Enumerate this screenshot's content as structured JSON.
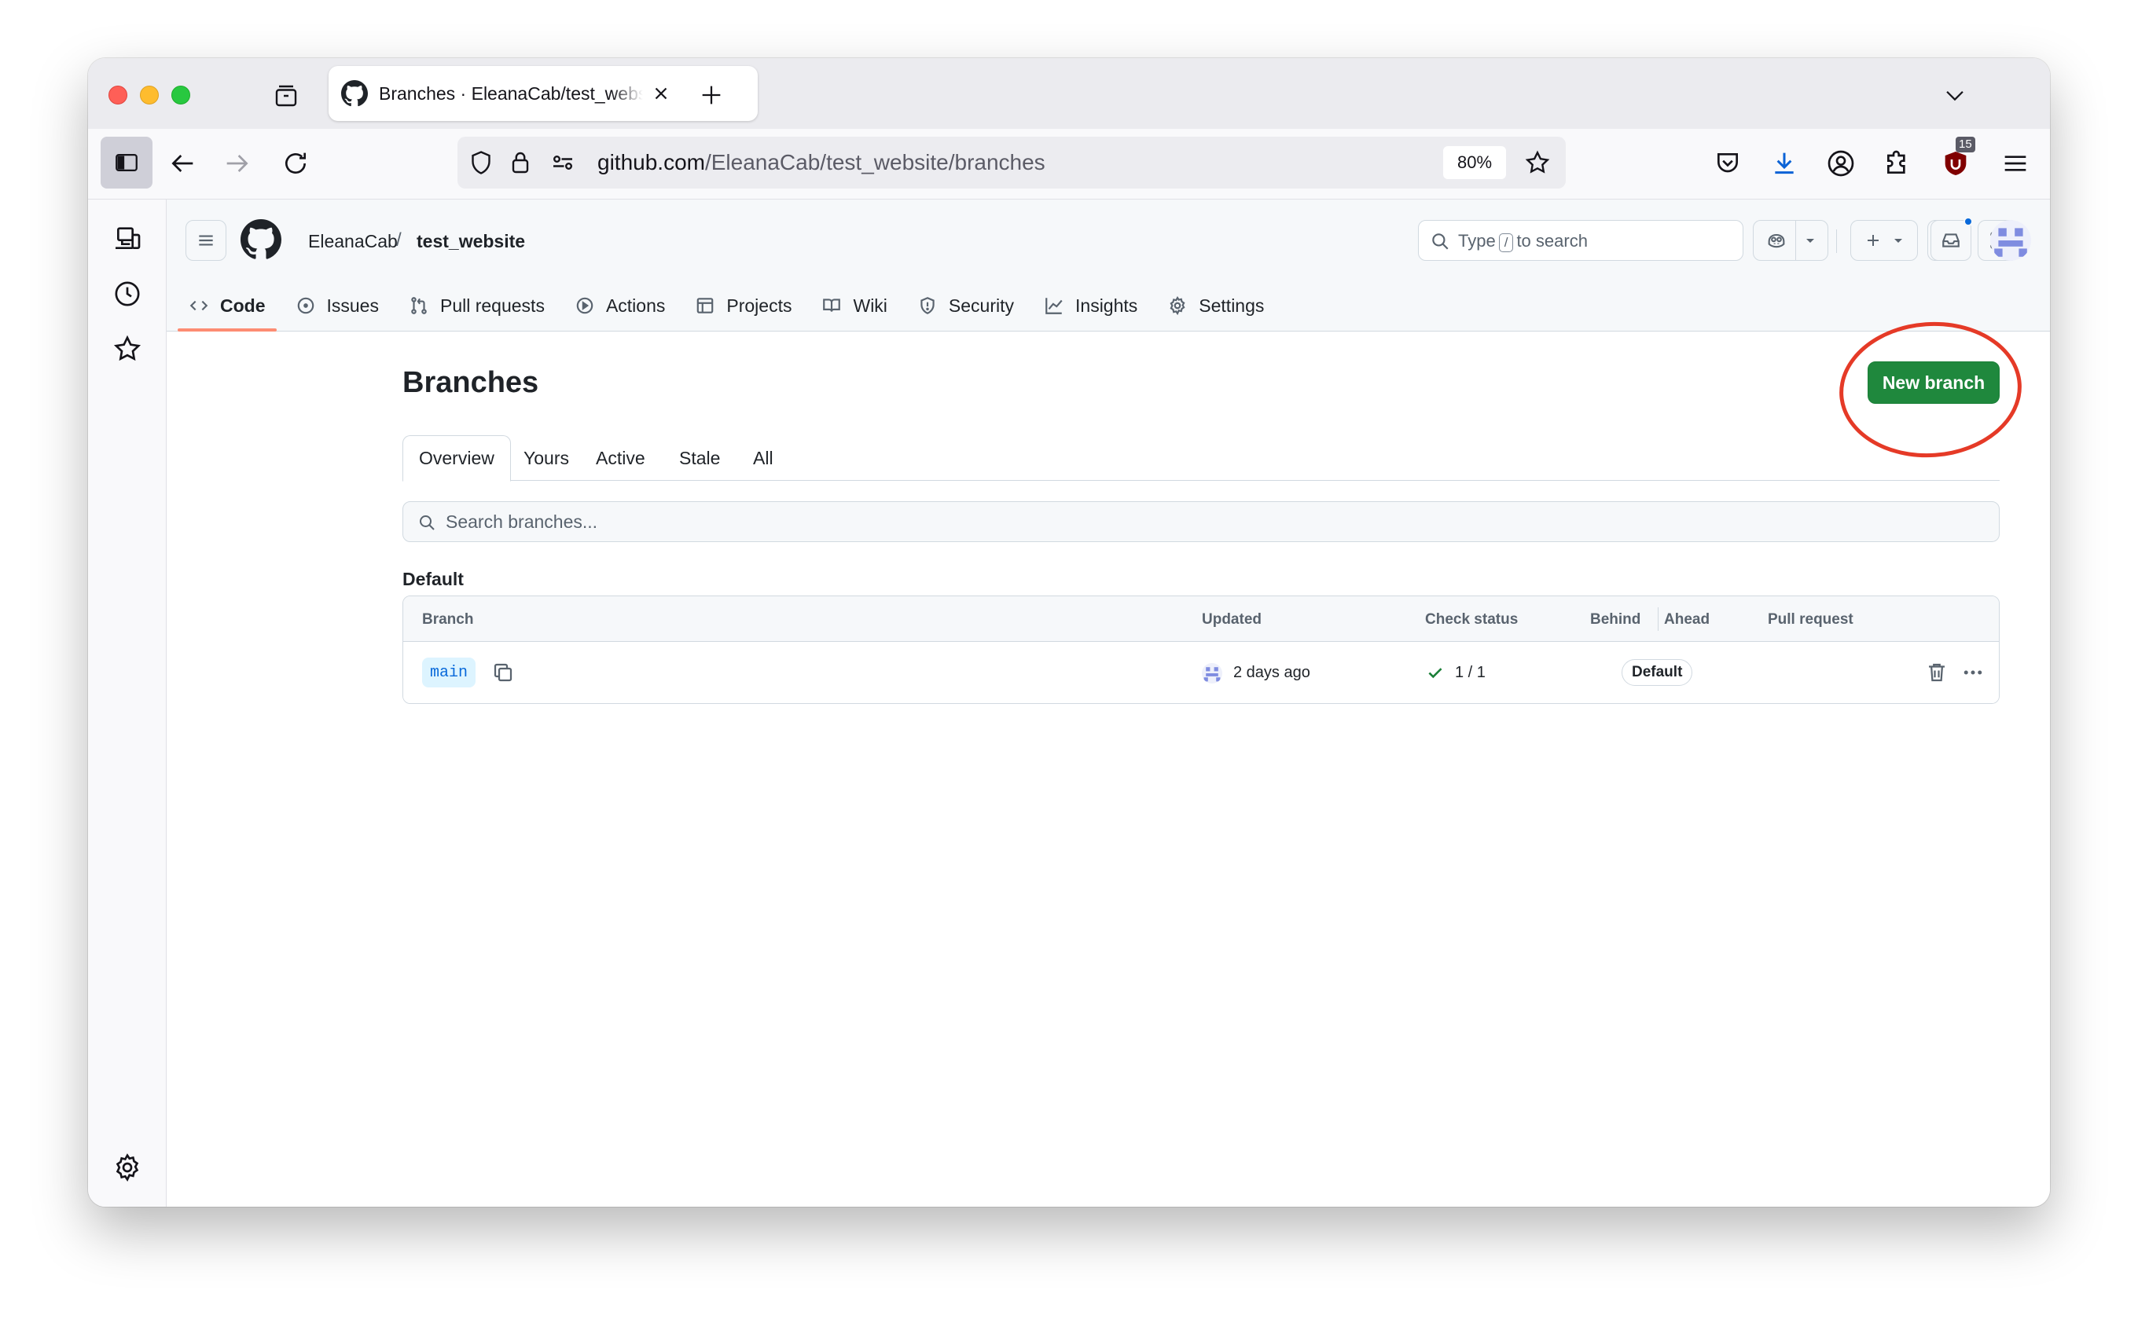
{
  "browser": {
    "tab": {
      "title": "Branches · EleanaCab/test_website",
      "favicon": "github-icon"
    },
    "url": {
      "host": "github.com",
      "path": "/EleanaCab/test_website/branches"
    },
    "zoom": "80%",
    "extension_badge": "15"
  },
  "header": {
    "owner": "EleanaCab",
    "separator": "/",
    "repo": "test_website",
    "search": {
      "prefix": "Type",
      "key": "/",
      "suffix": "to search"
    }
  },
  "repo_tabs": [
    {
      "label": "Code",
      "icon": "code-icon",
      "active": true
    },
    {
      "label": "Issues",
      "icon": "issue-icon"
    },
    {
      "label": "Pull requests",
      "icon": "pull-request-icon"
    },
    {
      "label": "Actions",
      "icon": "play-icon"
    },
    {
      "label": "Projects",
      "icon": "table-icon"
    },
    {
      "label": "Wiki",
      "icon": "book-icon"
    },
    {
      "label": "Security",
      "icon": "shield-icon"
    },
    {
      "label": "Insights",
      "icon": "graph-icon"
    },
    {
      "label": "Settings",
      "icon": "gear-icon"
    }
  ],
  "page": {
    "title": "Branches",
    "new_branch_label": "New branch",
    "sub_tabs": [
      "Overview",
      "Yours",
      "Active",
      "Stale",
      "All"
    ],
    "selected_sub_tab": "Overview",
    "search_placeholder": "Search branches...",
    "section_label": "Default"
  },
  "table": {
    "columns": {
      "branch": "Branch",
      "updated": "Updated",
      "check_status": "Check status",
      "behind": "Behind",
      "ahead": "Ahead",
      "pull_request": "Pull request"
    },
    "rows": [
      {
        "branch": "main",
        "updated": "2 days ago",
        "check_status": "1 / 1",
        "badge": "Default"
      }
    ]
  },
  "colors": {
    "primary_button": "#1f883d",
    "active_tab_underline": "#fd8c73",
    "annotation": "#e53a27",
    "link_blue": "#0969da"
  }
}
